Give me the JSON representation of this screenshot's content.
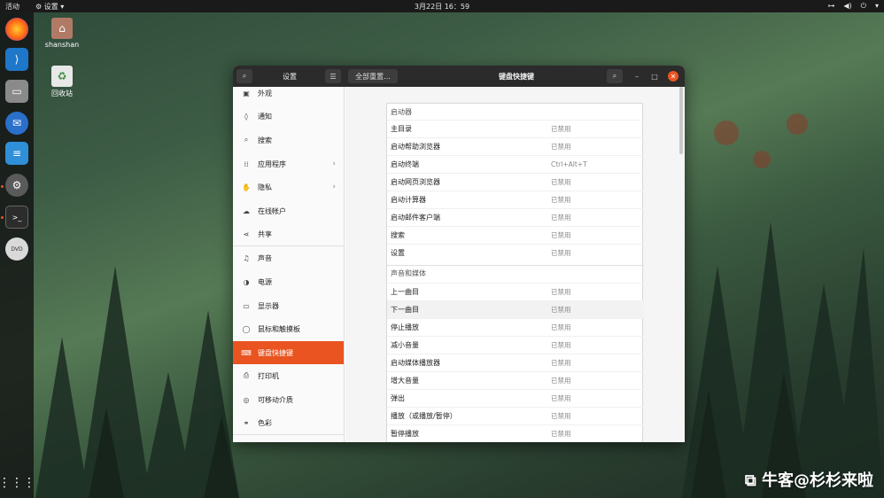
{
  "topbar": {
    "activities": "活动",
    "app_menu": "设置",
    "clock": "3月22日  16：59"
  },
  "desktop": {
    "home_label": "shanshan",
    "trash_label": "回收站"
  },
  "window": {
    "left_title": "设置",
    "reset_label": "全部重置...",
    "main_title": "键盘快捷键"
  },
  "sidebar": {
    "items": [
      {
        "label": "外观",
        "icon": "appearance-icon"
      },
      {
        "label": "通知",
        "icon": "bell-icon"
      },
      {
        "label": "搜索",
        "icon": "search-icon"
      },
      {
        "label": "应用程序",
        "icon": "apps-grid-icon",
        "arrow": "›"
      },
      {
        "label": "隐私",
        "icon": "hand-icon",
        "arrow": "›"
      },
      {
        "label": "在线帐户",
        "icon": "cloud-icon"
      },
      {
        "label": "共享",
        "icon": "share-icon"
      },
      {
        "label": "声音",
        "icon": "music-note-icon"
      },
      {
        "label": "电源",
        "icon": "power-icon"
      },
      {
        "label": "显示器",
        "icon": "monitor-icon"
      },
      {
        "label": "鼠标和触摸板",
        "icon": "mouse-icon"
      },
      {
        "label": "键盘快捷键",
        "icon": "keyboard-icon"
      },
      {
        "label": "打印机",
        "icon": "printer-icon"
      },
      {
        "label": "可移动介质",
        "icon": "removable-media-icon"
      },
      {
        "label": "色彩",
        "icon": "color-icon"
      }
    ]
  },
  "shortcuts": {
    "launchers_title": "启动器",
    "launchers": [
      {
        "name": "主目录",
        "key": "已禁用"
      },
      {
        "name": "启动帮助浏览器",
        "key": "已禁用"
      },
      {
        "name": "启动终端",
        "key": "Ctrl+Alt+T"
      },
      {
        "name": "启动网页浏览器",
        "key": "已禁用"
      },
      {
        "name": "启动计算器",
        "key": "已禁用"
      },
      {
        "name": "启动邮件客户端",
        "key": "已禁用"
      },
      {
        "name": "搜索",
        "key": "已禁用"
      },
      {
        "name": "设置",
        "key": "已禁用"
      }
    ],
    "media_title": "声音和媒体",
    "media": [
      {
        "name": "上一曲目",
        "key": "已禁用"
      },
      {
        "name": "下一曲目",
        "key": "已禁用"
      },
      {
        "name": "停止播放",
        "key": "已禁用"
      },
      {
        "name": "减小音量",
        "key": "已禁用"
      },
      {
        "name": "启动媒体播放器",
        "key": "已禁用"
      },
      {
        "name": "增大音量",
        "key": "已禁用"
      },
      {
        "name": "弹出",
        "key": "已禁用"
      },
      {
        "name": "播放（或播放/暂停）",
        "key": "已禁用"
      },
      {
        "name": "暂停播放",
        "key": "已禁用"
      }
    ]
  },
  "watermark": "牛客@杉杉来啦",
  "colors": {
    "accent": "#e95420",
    "header": "#2b2b2b",
    "dock": "#141414"
  }
}
